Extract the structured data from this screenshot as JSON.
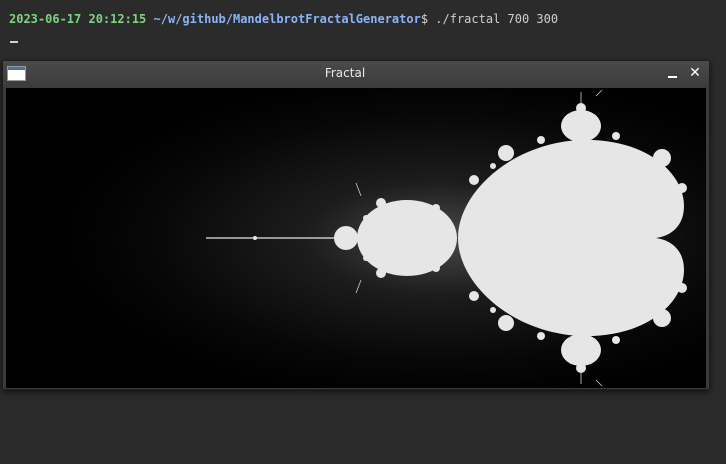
{
  "terminal": {
    "timestamp": "2023-06-17 20:12:15",
    "path": "~/w/github/MandelbrotFractalGenerator",
    "dollar": "$",
    "command": " ./fractal 700 300",
    "cursor": "_"
  },
  "window": {
    "title": "Fractal",
    "minimize_icon": "minimize-icon",
    "close_icon": "close-icon",
    "close_glyph": "✕"
  },
  "colors": {
    "terminal_bg": "#2b2b2b",
    "timestamp": "#7fd47f",
    "path": "#8ab4f8",
    "fractal_fill": "#e6e6e6",
    "canvas_bg": "#000000"
  }
}
